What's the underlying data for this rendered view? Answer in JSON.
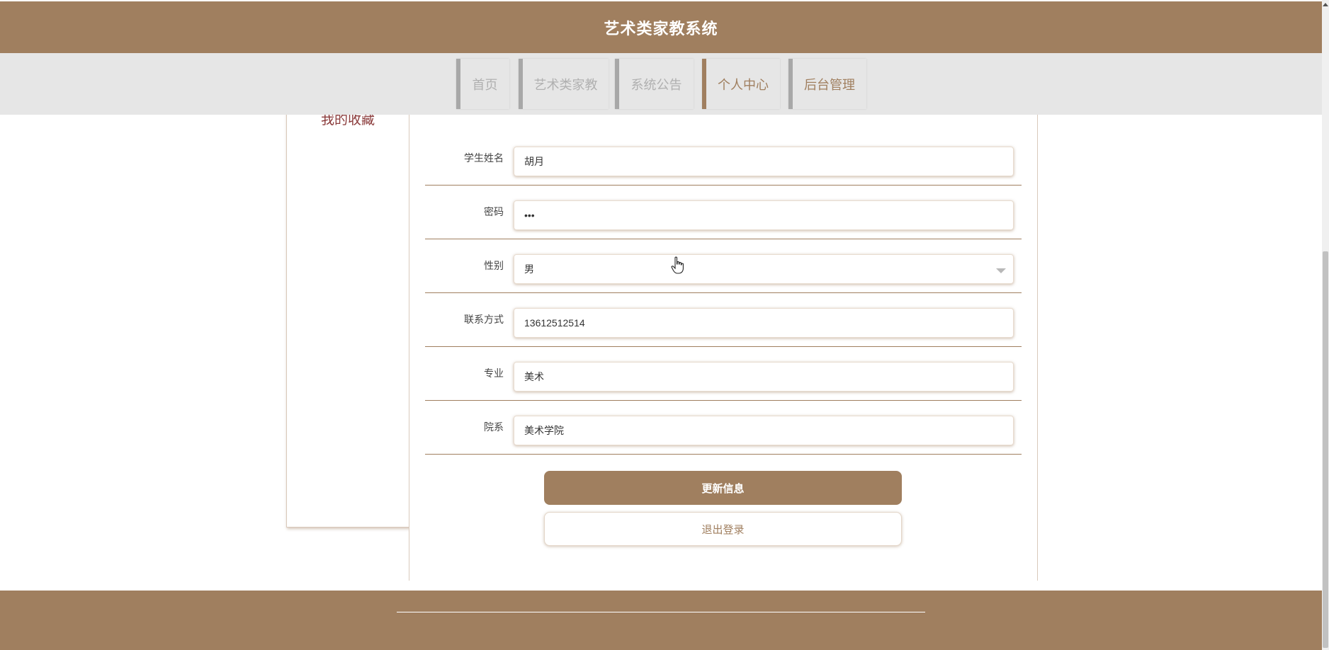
{
  "header": {
    "title": "艺术类家教系统"
  },
  "nav": {
    "items": [
      {
        "label": "首页"
      },
      {
        "label": "艺术类家教"
      },
      {
        "label": "系统公告"
      },
      {
        "label": "个人中心"
      },
      {
        "label": "后台管理"
      }
    ],
    "active": "个人中心"
  },
  "sidebar": {
    "link_label": "我的收藏"
  },
  "form": {
    "fields": [
      {
        "label": "学生姓名",
        "value": "胡月"
      },
      {
        "label": "密码",
        "value": "•••"
      },
      {
        "label": "性别",
        "value": "男"
      },
      {
        "label": "联系方式",
        "value": "13612512514"
      },
      {
        "label": "专业",
        "value": "美术"
      },
      {
        "label": "院系",
        "value": "美术学院"
      }
    ],
    "update_button": "更新信息",
    "logout_button": "退出登录"
  },
  "colors": {
    "brand": "#a07f5f",
    "nav_bg": "#e6e6e6",
    "sidebar_link": "#8a3a3a"
  }
}
